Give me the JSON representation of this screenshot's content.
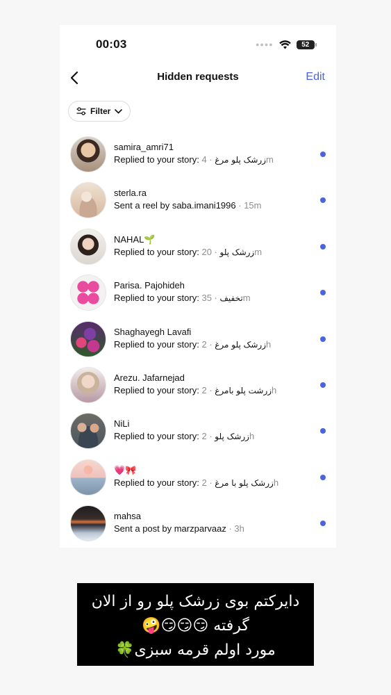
{
  "status_bar": {
    "time": "00:03",
    "battery": "52",
    "signal_icon": "signal-dots-icon",
    "wifi_icon": "wifi-icon"
  },
  "header": {
    "title": "Hidden requests",
    "edit_label": "Edit",
    "back_icon": "chevron-left-icon"
  },
  "filter": {
    "label": "Filter",
    "icon": "sliders-icon",
    "chevron": "chevron-down-icon"
  },
  "accent_color": "#4a64dd",
  "requests": [
    {
      "username": "samira_amri71",
      "action": "Replied to your story:",
      "message": "زرشک پلو مرغ",
      "time": "4m"
    },
    {
      "username": "sterla.ra",
      "action": "Sent a reel by saba.imani1996",
      "message": "",
      "time": "15m"
    },
    {
      "username": "NAHAL🌱",
      "action": "Replied to your story:",
      "message": "زرشک پلو",
      "time": "20m"
    },
    {
      "username": "Parisa. Pajohideh",
      "action": "Replied to your story:",
      "message": "تخفیف",
      "time": "35m"
    },
    {
      "username": "Shaghayegh Lavafi",
      "action": "Replied to your story:",
      "message": "زرشک پلو مرغ",
      "time": "2h"
    },
    {
      "username": "Arezu. Jafarnejad",
      "action": "Replied to your story:",
      "message": "زرشت پلو بامرغ",
      "time": "2h"
    },
    {
      "username": "NiLi",
      "action": "Replied to your story:",
      "message": "زرشک پلو",
      "time": "2h"
    },
    {
      "username": "💗🎀",
      "action": "Replied to your story:",
      "message": "زرشک پلو با مرغ",
      "time": "2h"
    },
    {
      "username": "mahsa",
      "action": "Sent a post by marzparvaaz",
      "message": "",
      "time": "3h"
    }
  ],
  "caption": {
    "line1": "دایرکتم بوی زرشک پلو رو از الان",
    "line2": "گرفته 😏😏😏🤪",
    "line3": "مورد اولم قرمه سبزی🍀"
  }
}
